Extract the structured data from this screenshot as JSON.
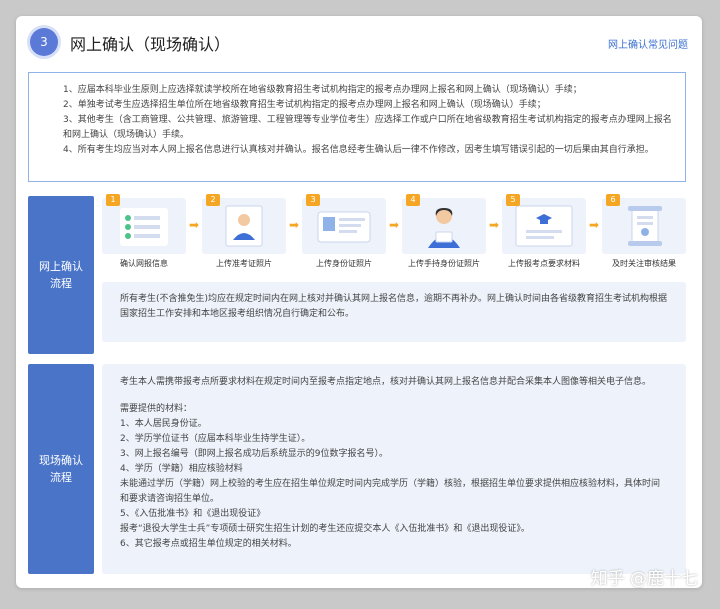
{
  "header": {
    "step_number": "3",
    "title": "网上确认（现场确认）",
    "faq_link": "网上确认常见问题"
  },
  "notice": {
    "lines": [
      "1、应届本科毕业生原则上应选择就读学校所在地省级教育招生考试机构指定的报考点办理网上报名和网上确认（现场确认）手续；",
      "2、单独考试考生应选择招生单位所在地省级教育招生考试机构指定的报考点办理网上报名和网上确认（现场确认）手续；",
      "3、其他考生（含工商管理、公共管理、旅游管理、工程管理等专业学位考生）应选择工作或户口所在地省级教育招生考试机构指定的报考点办理网上报名和网上确认（现场确认）手续。",
      "4、所有考生均应当对本人网上报名信息进行认真核对并确认。报名信息经考生确认后一律不作修改，因考生填写错误引起的一切后果由其自行承担。"
    ]
  },
  "online": {
    "label": "网上确认流程",
    "steps": [
      {
        "num": "1",
        "caption": "确认网报信息",
        "icon": "form-check-icon"
      },
      {
        "num": "2",
        "caption": "上传准考证照片",
        "icon": "id-photo-icon"
      },
      {
        "num": "3",
        "caption": "上传身份证照片",
        "icon": "id-card-icon"
      },
      {
        "num": "4",
        "caption": "上传手持身份证照片",
        "icon": "person-holding-id-icon"
      },
      {
        "num": "5",
        "caption": "上传报考点要求材料",
        "icon": "graduation-cap-icon"
      },
      {
        "num": "6",
        "caption": "及时关注审核结果",
        "icon": "scroll-icon"
      }
    ],
    "info": "所有考生(不含推免生)均应在规定时间内在网上核对并确认其网上报名信息，逾期不再补办。网上确认时间由各省级教育招生考试机构根据国家招生工作安排和本地区报考组织情况自行确定和公布。"
  },
  "onsite": {
    "label": "现场确认流程",
    "intro": "考生本人需携带报考点所要求材料在规定时间内至报考点指定地点，核对并确认其网上报名信息并配合采集本人图像等相关电子信息。",
    "materials_title": "需要提供的材料：",
    "materials": [
      "1、本人居民身份证。",
      "2、学历学位证书（应届本科毕业生持学生证）。",
      "3、网上报名编号（即网上报名成功后系统显示的9位数字报名号）。",
      "4、学历（学籍）相应核验材料",
      "未能通过学历（学籍）网上校验的考生应在招生单位规定时间内完成学历（学籍）核验，根据招生单位要求提供相应核验材料，具体时间和要求请咨询招生单位。",
      "5、《入伍批准书》和《退出现役证》",
      "报考“退役大学生士兵”专项硕士研究生招生计划的考生还应提交本人《入伍批准书》和《退出现役证》。",
      "6、其它报考点或招生单位规定的相关材料。"
    ]
  },
  "watermark": "知乎 @鹿十七",
  "colors": {
    "accent": "#4a74c8",
    "step_badge": "#f5a623",
    "light_panel": "#eef3fb",
    "notice_border": "#8fb3e8"
  }
}
